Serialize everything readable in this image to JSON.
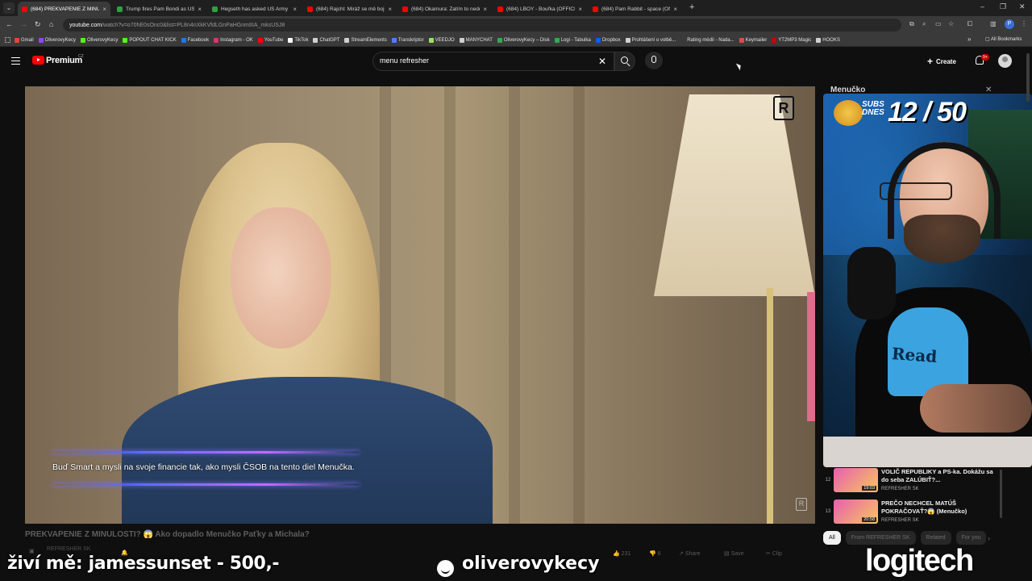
{
  "browser": {
    "tabs": [
      {
        "label": "(684) PREKVAPENIE Z MINULOSTI",
        "color": "#ff0000",
        "active": true
      },
      {
        "label": "Trump fires Pam Bondi as US a",
        "color": "#2ea043",
        "active": false
      },
      {
        "label": "Hegseth has asked US Army ch",
        "color": "#2ea043",
        "active": false
      },
      {
        "label": "(684) Rajchl: Miráž se mě bojí",
        "color": "#ff0000",
        "active": false
      },
      {
        "label": "(684) Okamura: Zatím to nedělá",
        "color": "#ff0000",
        "active": false
      },
      {
        "label": "(684) LBOY - Bouřka (OFFICIAL",
        "color": "#ff0000",
        "active": false
      },
      {
        "label": "(684) Pam Rabbit - space (Offic",
        "color": "#ff0000",
        "active": false
      }
    ],
    "new_tab_symbol": "+",
    "window_controls": {
      "minimize": "–",
      "maximize": "❐",
      "close": "✕"
    },
    "address": {
      "host": "youtube.com",
      "path": "/watch?v=o70hE0sOnc0&list=PL8n4nXkKVfdLGnPaHGnmIIIA_mksUSJ8"
    },
    "bookmarks": [
      {
        "label": "Gmail",
        "color": "#ea4335"
      },
      {
        "label": "OliverovyKecy",
        "color": "#9146ff"
      },
      {
        "label": "OliverovyKecy",
        "color": "#53fc18"
      },
      {
        "label": "POPOUT CHAT KICK",
        "color": "#53fc18"
      },
      {
        "label": "Facebook",
        "color": "#1877f2"
      },
      {
        "label": "Instagram - OK",
        "color": "#e1306c"
      },
      {
        "label": "YouTube",
        "color": "#ff0000"
      },
      {
        "label": "TikTok",
        "color": "#ffffff"
      },
      {
        "label": "ChatGPT",
        "color": "#cfcfcf"
      },
      {
        "label": "StreamElements",
        "color": "#cfcfcf"
      },
      {
        "label": "Transkriptor",
        "color": "#4f7cff"
      },
      {
        "label": "VEEDJO",
        "color": "#9be15d"
      },
      {
        "label": "MANYCHAT",
        "color": "#cfcfcf"
      },
      {
        "label": "OliverovyKecy – Disk",
        "color": "#34a853"
      },
      {
        "label": "Logi - Tabulka",
        "color": "#34a853"
      },
      {
        "label": "Dropbox",
        "color": "#0061ff"
      },
      {
        "label": "Prohlášení o volbě...",
        "color": "#cfcfcf"
      },
      {
        "label": "Rating médií - Nada...",
        "color": "#3a3a3a"
      },
      {
        "label": "Keymailer",
        "color": "#e04a4a"
      },
      {
        "label": "YT2MP3 Magic",
        "color": "#cc0000"
      },
      {
        "label": "HOOKS",
        "color": "#cfcfcf"
      }
    ],
    "all_bookmarks": "All Bookmarks",
    "bookmarks_more": "»"
  },
  "youtube": {
    "logo_label": "Premium",
    "country_code": "CZ",
    "search": {
      "value": "menu refresher",
      "clear": "✕"
    },
    "create_label": "Create",
    "notification_count": "9+",
    "video": {
      "subtitle": "Buď Smart a mysli na svoje financie tak, ako mysli ČSOB na tento diel Menučka.",
      "watermark": "R",
      "title": "PREKVAPENIE Z MINULOSTI? 😱 Ako dopadlo Menučko Paťky a Michala?",
      "channel": "REFRESHER SK",
      "actions": [
        {
          "label": "231",
          "icon": "like-icon"
        },
        {
          "label": "6",
          "icon": "dislike-icon"
        },
        {
          "label": "Share",
          "icon": "share-icon"
        },
        {
          "label": "Save",
          "icon": "save-icon"
        },
        {
          "label": "Clip",
          "icon": "clip-icon"
        }
      ]
    },
    "playlist": {
      "title": "Menučko",
      "close": "✕",
      "items": [
        {
          "index": "12",
          "title": "VOLIČ REPUBLIKY a PS-ka. Dokážu sa do seba ZALÚBIŤ?...",
          "channel": "REFRESHER SK",
          "duration": "19:03"
        },
        {
          "index": "13",
          "title": "PREČO NECHCEL MATÚŠ POKRAČOVAŤ?😱 (Menučko)",
          "channel": "REFRESHER SK",
          "duration": "20:58"
        }
      ]
    },
    "chips": [
      {
        "label": "All",
        "active": true
      },
      {
        "label": "From REFRESHER SK",
        "active": false
      },
      {
        "label": "Related",
        "active": false
      },
      {
        "label": "For you",
        "active": false
      }
    ],
    "chips_next": "›"
  },
  "stream_overlay": {
    "subs_label": "SUBS DNES",
    "subs_count": "12 / 50",
    "shirt_print": "Read",
    "donor_text": "živí mě: jamessunset - 500,-",
    "handle": "oliverovykecy",
    "brand": "logitech"
  }
}
